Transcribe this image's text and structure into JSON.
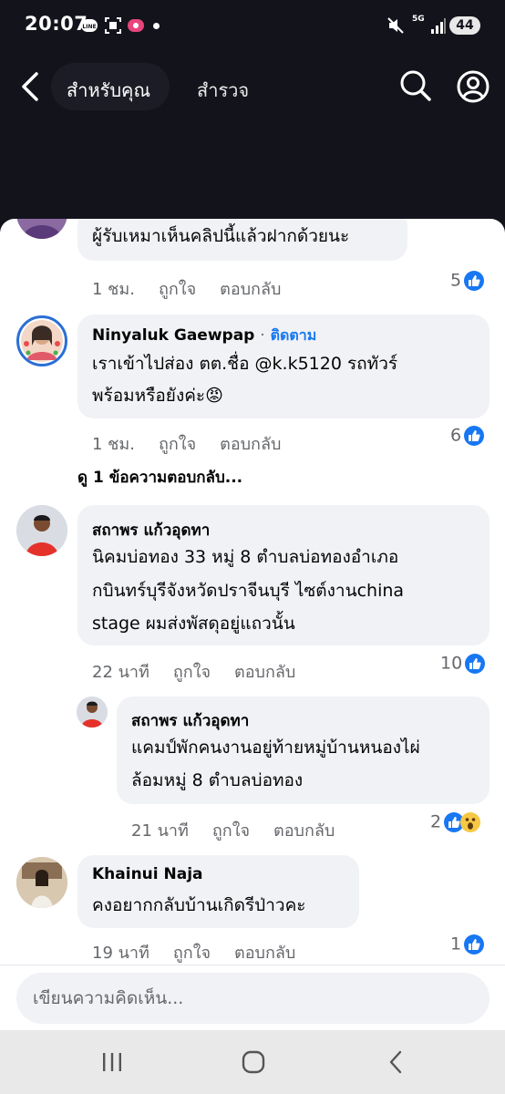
{
  "status_bar": {
    "time": "20:07",
    "network": "5G",
    "battery": "44",
    "icons": [
      "line-icon",
      "screenshot-icon",
      "notification-icon",
      "mute-icon",
      "signal-icon"
    ]
  },
  "nav": {
    "tab_for_you": "สำหรับคุณ",
    "tab_explore": "สำรวจ"
  },
  "comments": [
    {
      "text": "ผู้รับเหมาเห็นคลิปนี้แล้วฝากด้วยนะ",
      "time": "1 ชม.",
      "like_label": "ถูกใจ",
      "reply_label": "ตอบกลับ",
      "reactions": "5"
    },
    {
      "author": "Ninyaluk Gaewpap",
      "follow_dot": "·",
      "follow_label": "ติดตาม",
      "text_line1": "เราเข้าไปส่อง ตต.ชื่อ @k.k5120 รถทัวร์",
      "text_line2": "พร้อมหรือยังค่ะ😡",
      "time": "1 ชม.",
      "like_label": "ถูกใจ",
      "reply_label": "ตอบกลับ",
      "reactions": "6"
    },
    {
      "author": "สถาพร แก้วอุดทา",
      "text_line1": "นิคมบ่อทอง 33 หมู่ 8 ตำบลบ่อทองอำเภอ",
      "text_line2": "กบินทร์บุรีจังหวัดปราจีนบุรี ไซต์งานchina",
      "text_line3": "stage ผมส่งพัสดุอยู่แถวนั้น",
      "time": "22 นาที",
      "like_label": "ถูกใจ",
      "reply_label": "ตอบกลับ",
      "reactions": "10"
    },
    {
      "author": "สถาพร แก้วอุดทา",
      "text_line1": "แคมป์พักคนงานอยู่ท้ายหมู่บ้านหนองไผ่",
      "text_line2": "ล้อมหมู่ 8 ตำบลบ่อทอง",
      "time": "21 นาที",
      "like_label": "ถูกใจ",
      "reply_label": "ตอบกลับ",
      "reactions": "2"
    },
    {
      "author": "Khainui Naja",
      "text_line1": "คงอยากกลับบ้านเกิดรีป่าวคะ",
      "time": "19 นาที",
      "like_label": "ถูกใจ",
      "reply_label": "ตอบกลับ",
      "reactions": "1"
    }
  ],
  "see_replies": "ดู 1 ข้อความตอบกลับ...",
  "composer": {
    "placeholder": "เขียนความคิดเห็น..."
  },
  "colors": {
    "accent": "#1877f2",
    "dark_bg": "#13131c",
    "bubble": "#f0f2f5"
  }
}
